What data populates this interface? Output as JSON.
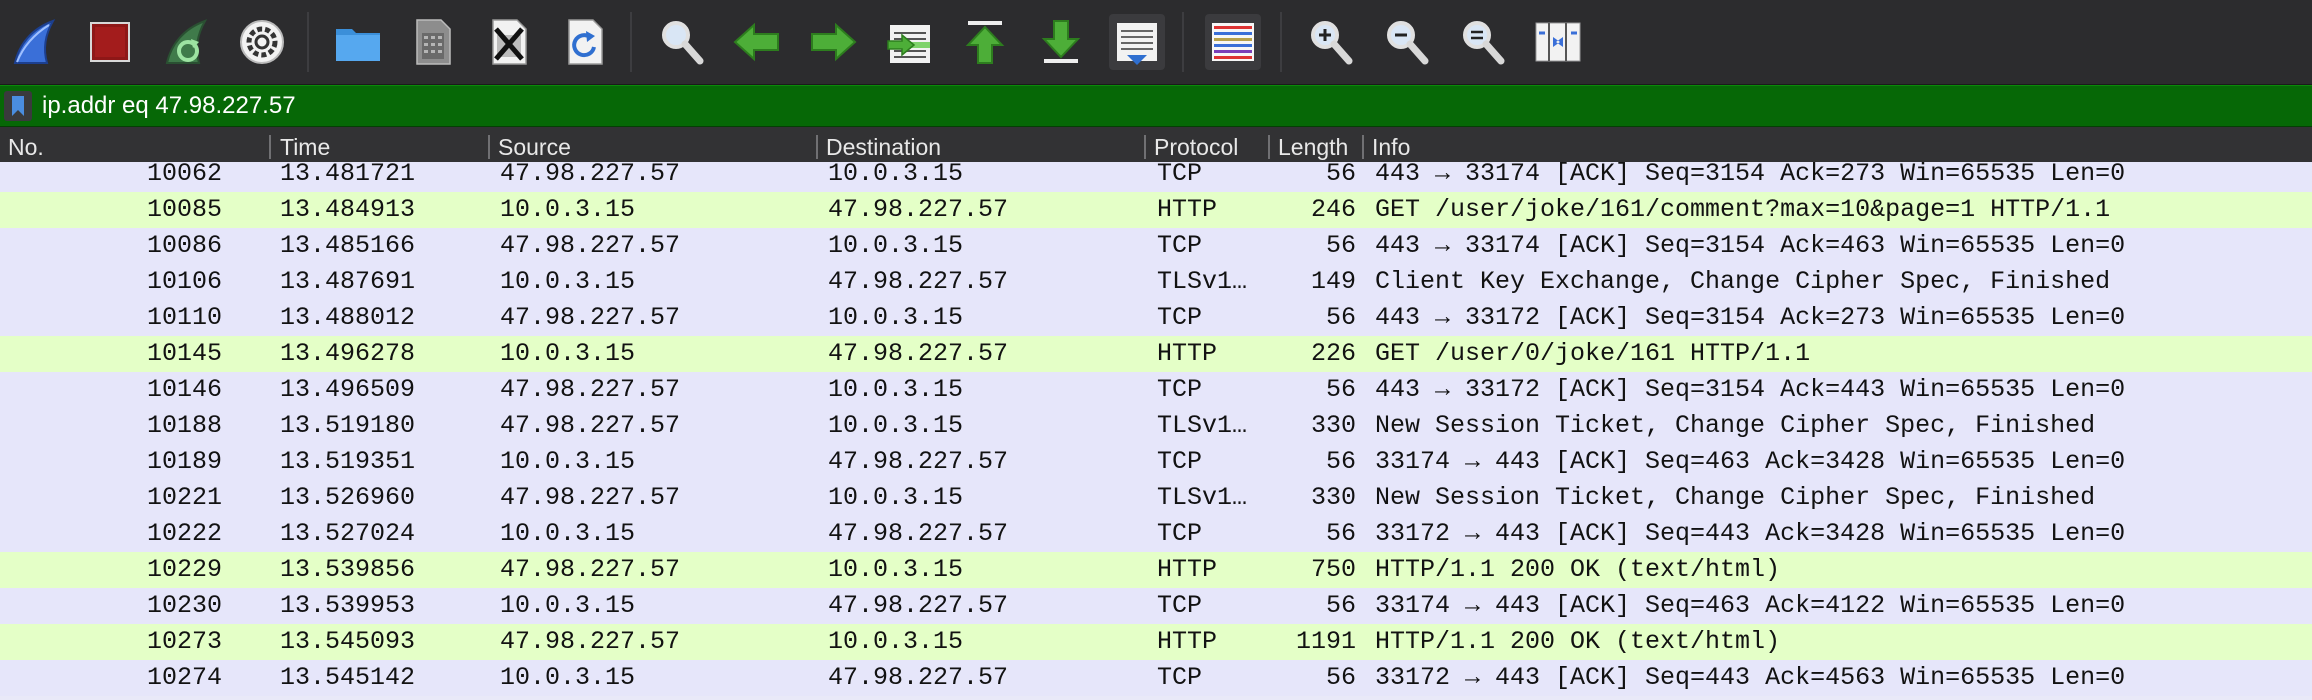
{
  "toolbar": {
    "buttons": [
      {
        "name": "start-capture-icon"
      },
      {
        "name": "stop-capture-icon"
      },
      {
        "name": "restart-capture-icon"
      },
      {
        "name": "capture-options-icon"
      },
      {
        "name": "open-file-icon"
      },
      {
        "name": "save-file-icon"
      },
      {
        "name": "close-file-icon"
      },
      {
        "name": "reload-file-icon"
      },
      {
        "name": "find-packet-icon"
      },
      {
        "name": "go-back-icon"
      },
      {
        "name": "go-forward-icon"
      },
      {
        "name": "go-to-packet-icon"
      },
      {
        "name": "first-packet-icon"
      },
      {
        "name": "last-packet-icon"
      },
      {
        "name": "auto-scroll-icon"
      },
      {
        "name": "colorize-icon"
      },
      {
        "name": "zoom-in-icon"
      },
      {
        "name": "zoom-out-icon"
      },
      {
        "name": "normal-size-icon"
      },
      {
        "name": "resize-columns-icon"
      }
    ]
  },
  "filter": {
    "value": "ip.addr eq 47.98.227.57"
  },
  "columns": [
    "No.",
    "Time",
    "Source",
    "Destination",
    "Protocol",
    "Length",
    "Info"
  ],
  "colors": {
    "tcp_row": "#e6e6fa",
    "http_row": "#e4ffc7",
    "filter_bg": "#066806",
    "toolbar_bg": "#2c2c2e"
  },
  "packets": [
    {
      "no": "10062",
      "time": "13.481721",
      "src": "47.98.227.57",
      "dst": "10.0.3.15",
      "proto": "TCP",
      "len": "56",
      "info": "443 → 33174 [ACK] Seq=3154 Ack=273 Win=65535 Len=0"
    },
    {
      "no": "10085",
      "time": "13.484913",
      "src": "10.0.3.15",
      "dst": "47.98.227.57",
      "proto": "HTTP",
      "len": "246",
      "info": "GET /user/joke/161/comment?max=10&page=1 HTTP/1.1"
    },
    {
      "no": "10086",
      "time": "13.485166",
      "src": "47.98.227.57",
      "dst": "10.0.3.15",
      "proto": "TCP",
      "len": "56",
      "info": "443 → 33174 [ACK] Seq=3154 Ack=463 Win=65535 Len=0"
    },
    {
      "no": "10106",
      "time": "13.487691",
      "src": "10.0.3.15",
      "dst": "47.98.227.57",
      "proto": "TLSv1…",
      "len": "149",
      "info": "Client Key Exchange, Change Cipher Spec, Finished"
    },
    {
      "no": "10110",
      "time": "13.488012",
      "src": "47.98.227.57",
      "dst": "10.0.3.15",
      "proto": "TCP",
      "len": "56",
      "info": "443 → 33172 [ACK] Seq=3154 Ack=273 Win=65535 Len=0"
    },
    {
      "no": "10145",
      "time": "13.496278",
      "src": "10.0.3.15",
      "dst": "47.98.227.57",
      "proto": "HTTP",
      "len": "226",
      "info": "GET /user/0/joke/161 HTTP/1.1"
    },
    {
      "no": "10146",
      "time": "13.496509",
      "src": "47.98.227.57",
      "dst": "10.0.3.15",
      "proto": "TCP",
      "len": "56",
      "info": "443 → 33172 [ACK] Seq=3154 Ack=443 Win=65535 Len=0"
    },
    {
      "no": "10188",
      "time": "13.519180",
      "src": "47.98.227.57",
      "dst": "10.0.3.15",
      "proto": "TLSv1…",
      "len": "330",
      "info": "New Session Ticket, Change Cipher Spec, Finished"
    },
    {
      "no": "10189",
      "time": "13.519351",
      "src": "10.0.3.15",
      "dst": "47.98.227.57",
      "proto": "TCP",
      "len": "56",
      "info": "33174 → 443 [ACK] Seq=463 Ack=3428 Win=65535 Len=0"
    },
    {
      "no": "10221",
      "time": "13.526960",
      "src": "47.98.227.57",
      "dst": "10.0.3.15",
      "proto": "TLSv1…",
      "len": "330",
      "info": "New Session Ticket, Change Cipher Spec, Finished"
    },
    {
      "no": "10222",
      "time": "13.527024",
      "src": "10.0.3.15",
      "dst": "47.98.227.57",
      "proto": "TCP",
      "len": "56",
      "info": "33172 → 443 [ACK] Seq=443 Ack=3428 Win=65535 Len=0"
    },
    {
      "no": "10229",
      "time": "13.539856",
      "src": "47.98.227.57",
      "dst": "10.0.3.15",
      "proto": "HTTP",
      "len": "750",
      "info": "HTTP/1.1 200 OK  (text/html)"
    },
    {
      "no": "10230",
      "time": "13.539953",
      "src": "10.0.3.15",
      "dst": "47.98.227.57",
      "proto": "TCP",
      "len": "56",
      "info": "33174 → 443 [ACK] Seq=463 Ack=4122 Win=65535 Len=0"
    },
    {
      "no": "10273",
      "time": "13.545093",
      "src": "47.98.227.57",
      "dst": "10.0.3.15",
      "proto": "HTTP",
      "len": "1191",
      "info": "HTTP/1.1 200 OK  (text/html)"
    },
    {
      "no": "10274",
      "time": "13.545142",
      "src": "10.0.3.15",
      "dst": "47.98.227.57",
      "proto": "TCP",
      "len": "56",
      "info": "33172 → 443 [ACK] Seq=443 Ack=4563 Win=65535 Len=0"
    }
  ]
}
